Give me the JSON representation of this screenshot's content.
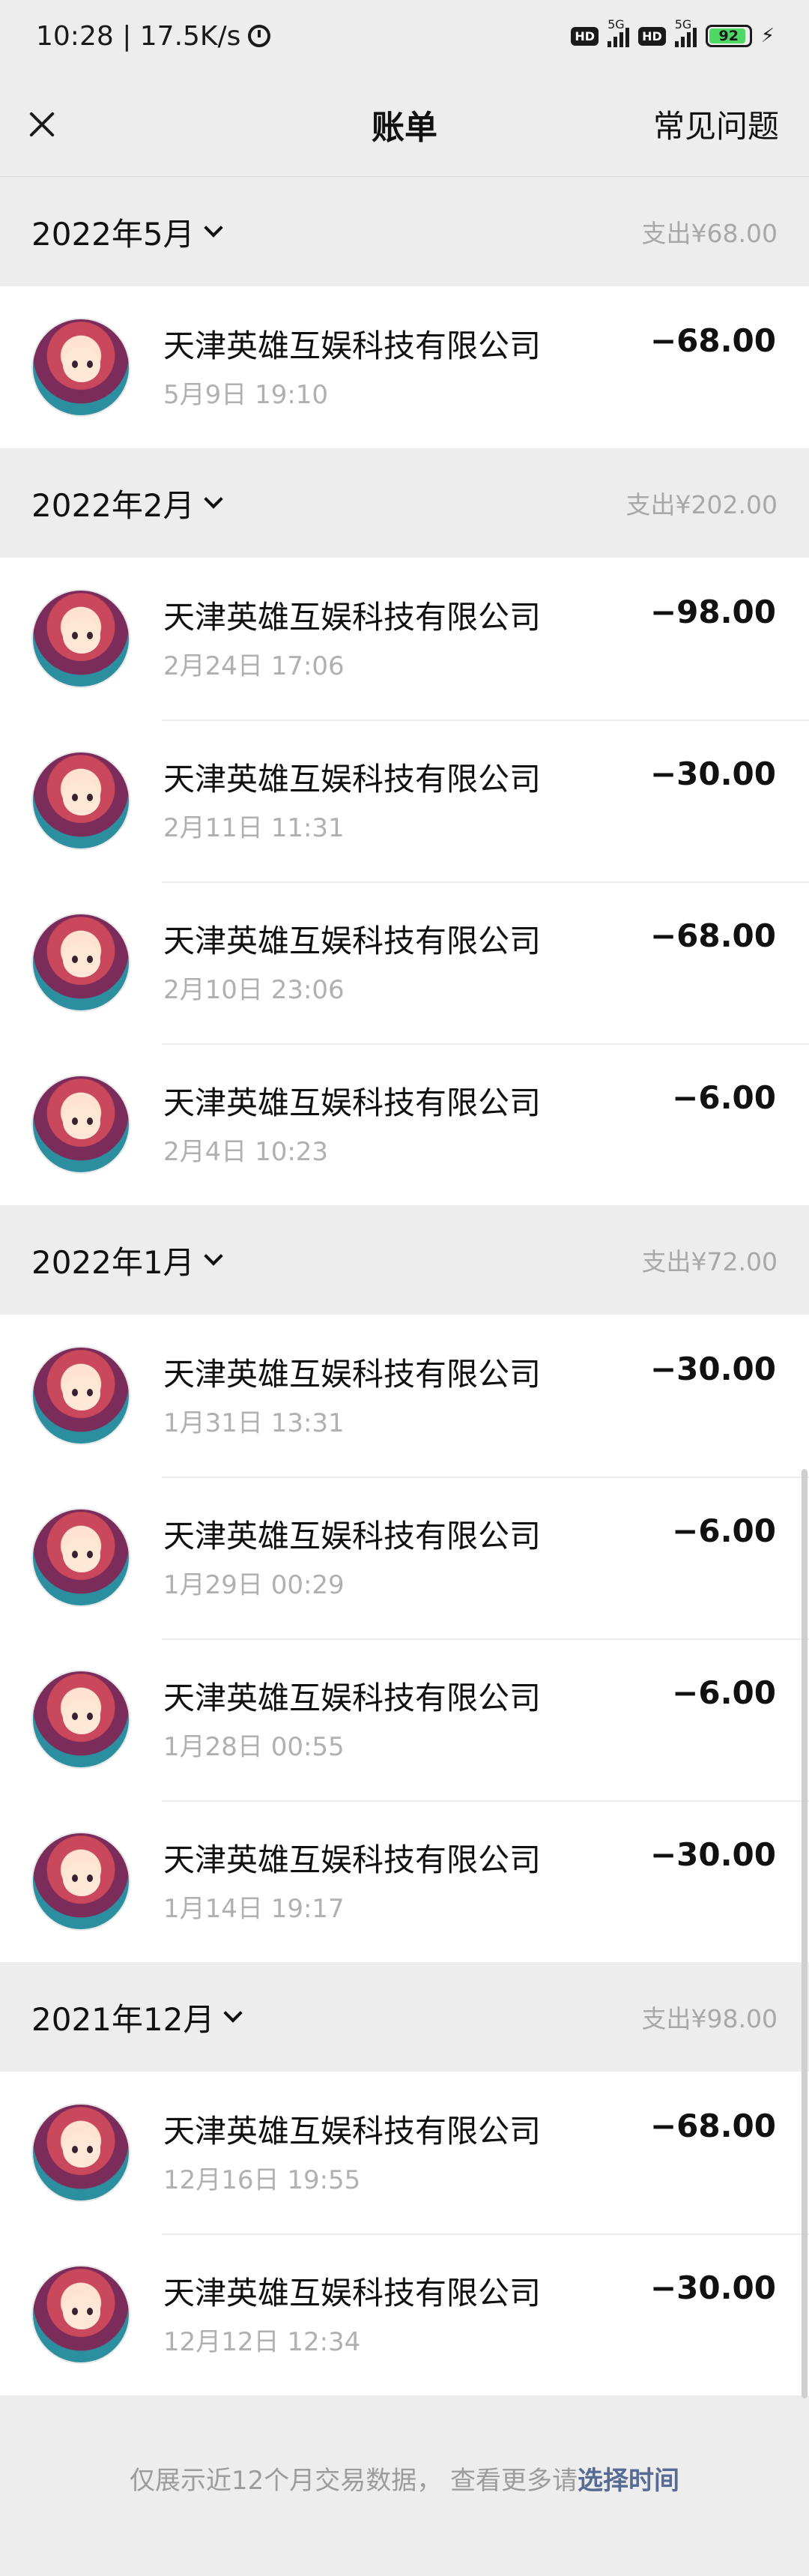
{
  "status_bar": {
    "time": "10:28",
    "network_speed": "17.5K/s",
    "sim1_label": "HD",
    "sim1_network": "5G",
    "sim2_label": "HD",
    "sim2_network": "5G",
    "battery_level": "92"
  },
  "nav": {
    "title": "账单",
    "faq_label": "常见问题"
  },
  "months": [
    {
      "label": "2022年5月",
      "total": "支出¥68.00",
      "transactions": [
        {
          "name": "天津英雄互娱科技有限公司",
          "time": "5月9日 19:10",
          "amount": "−68.00"
        }
      ]
    },
    {
      "label": "2022年2月",
      "total": "支出¥202.00",
      "transactions": [
        {
          "name": "天津英雄互娱科技有限公司",
          "time": "2月24日 17:06",
          "amount": "−98.00"
        },
        {
          "name": "天津英雄互娱科技有限公司",
          "time": "2月11日 11:31",
          "amount": "−30.00"
        },
        {
          "name": "天津英雄互娱科技有限公司",
          "time": "2月10日 23:06",
          "amount": "−68.00"
        },
        {
          "name": "天津英雄互娱科技有限公司",
          "time": "2月4日 10:23",
          "amount": "−6.00"
        }
      ]
    },
    {
      "label": "2022年1月",
      "total": "支出¥72.00",
      "transactions": [
        {
          "name": "天津英雄互娱科技有限公司",
          "time": "1月31日 13:31",
          "amount": "−30.00"
        },
        {
          "name": "天津英雄互娱科技有限公司",
          "time": "1月29日 00:29",
          "amount": "−6.00"
        },
        {
          "name": "天津英雄互娱科技有限公司",
          "time": "1月28日 00:55",
          "amount": "−6.00"
        },
        {
          "name": "天津英雄互娱科技有限公司",
          "time": "1月14日 19:17",
          "amount": "−30.00"
        }
      ]
    },
    {
      "label": "2021年12月",
      "total": "支出¥98.00",
      "transactions": [
        {
          "name": "天津英雄互娱科技有限公司",
          "time": "12月16日 19:55",
          "amount": "−68.00"
        },
        {
          "name": "天津英雄互娱科技有限公司",
          "time": "12月12日 12:34",
          "amount": "−30.00"
        }
      ]
    }
  ],
  "footer": {
    "text": "仅展示近12个月交易数据， 查看更多请",
    "link": "选择时间"
  },
  "icons": {
    "close": "close-icon",
    "chevron": "chevron-down-icon",
    "avatar": "merchant-avatar",
    "alarm": "alarm-icon"
  },
  "colors": {
    "background": "#ededed",
    "link": "#576b95",
    "muted": "#a8a8a8"
  }
}
